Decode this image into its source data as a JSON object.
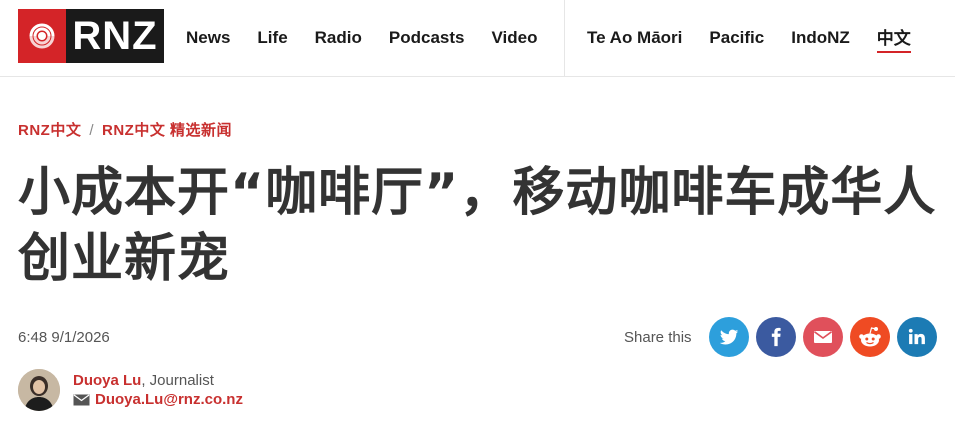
{
  "header": {
    "logo_text": "RNZ",
    "nav_main": [
      "News",
      "Life",
      "Radio",
      "Podcasts",
      "Video"
    ],
    "nav_lang": [
      "Te Ao Māori",
      "Pacific",
      "IndoNZ",
      "中文"
    ],
    "active_lang": "中文"
  },
  "breadcrumb": {
    "items": [
      "RNZ中文",
      "RNZ中文 精选新闻"
    ],
    "separator": "/"
  },
  "article": {
    "headline": "小成本开“咖啡厅”，移动咖啡车成华人创业新宠",
    "timestamp": "6:48 9/1/2026"
  },
  "share": {
    "label": "Share this",
    "buttons": [
      {
        "icon": "twitter-icon",
        "color": "#2d9fdc"
      },
      {
        "icon": "facebook-icon",
        "color": "#3b5aa0"
      },
      {
        "icon": "email-icon",
        "color": "#e0505b"
      },
      {
        "icon": "reddit-icon",
        "color": "#ef4b23"
      },
      {
        "icon": "linkedin-icon",
        "color": "#1c7bb4"
      }
    ]
  },
  "author": {
    "name": "Duoya Lu",
    "role": ", Journalist",
    "email": "Duoya.Lu@rnz.co.nz"
  },
  "colors": {
    "brand_red": "#d42428",
    "link_red": "#c8302f",
    "text": "#333333"
  }
}
